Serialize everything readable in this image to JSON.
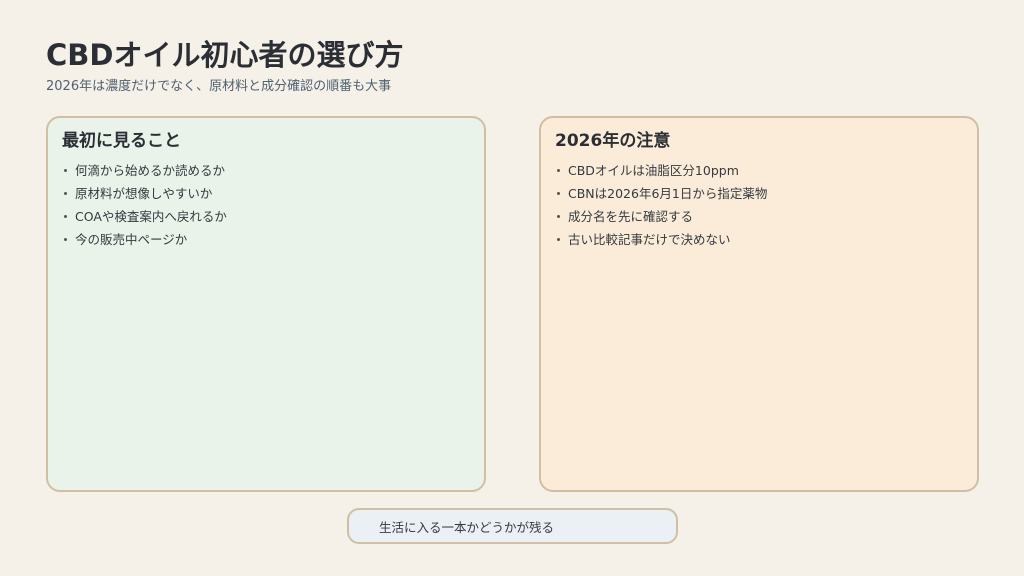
{
  "header": {
    "title": "CBDオイル初心者の選び方",
    "subtitle": "2026年は濃度だけでなく、原材料と成分確認の順番も大事"
  },
  "cards": [
    {
      "title": "最初に見ること",
      "items": [
        "何滴から始めるか読めるか",
        "原材料が想像しやすいか",
        "COAや検査案内へ戻れるか",
        "今の販売中ページか"
      ]
    },
    {
      "title": "2026年の注意",
      "items": [
        "CBDオイルは油脂区分10ppm",
        "CBNは2026年6月1日から指定薬物",
        "成分名を先に確認する",
        "古い比較記事だけで決めない"
      ]
    }
  ],
  "footer": {
    "text": "生活に入る一本かどうかが残る"
  },
  "colors": {
    "background": "#f5f0e8",
    "left_card": "#eaf3ea",
    "right_card": "#faecd9",
    "border": "#d0bfa5",
    "footer_box": "#eaf0f3"
  }
}
